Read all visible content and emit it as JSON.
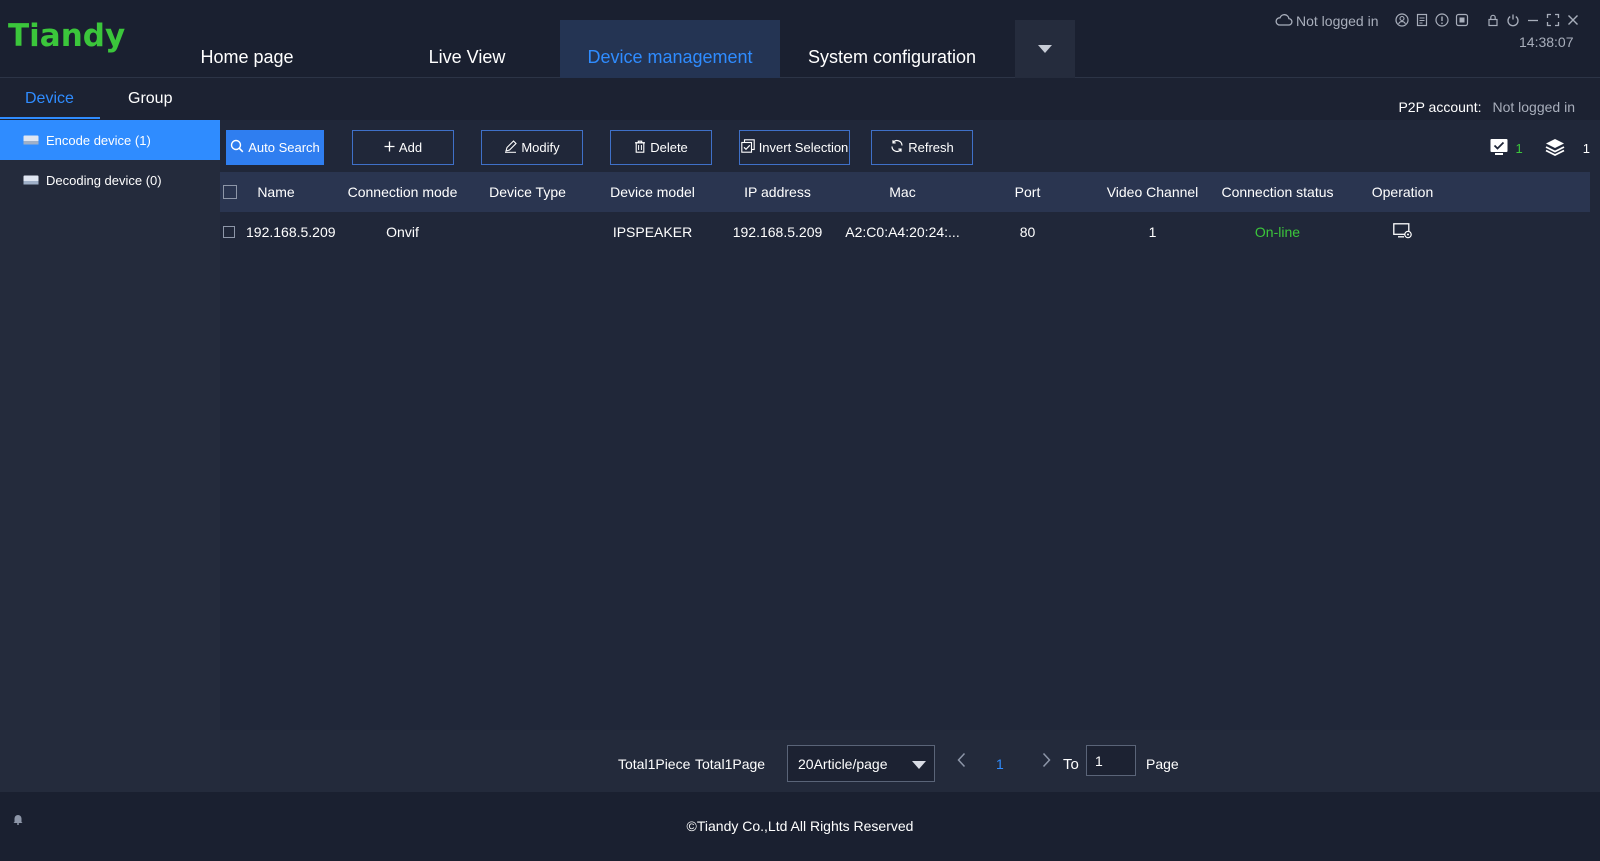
{
  "app": {
    "logo": "Tiandy",
    "nav": [
      "Home page",
      "Live View",
      "Device management",
      "System configuration"
    ],
    "active_nav": "Device management",
    "cloud_status": "Not logged in",
    "clock": "14:38:07"
  },
  "subnav": {
    "tabs": [
      "Device",
      "Group"
    ],
    "active_tab": "Device",
    "p2p_label": "P2P account:",
    "p2p_value": "Not logged in"
  },
  "sidebar": {
    "items": [
      {
        "label": "Encode device (1)",
        "icon": "device-icon"
      },
      {
        "label": "Decoding device (0)",
        "icon": "device-icon"
      }
    ],
    "active_index": 0
  },
  "toolbar": {
    "auto_search": "Auto Search",
    "add": "Add",
    "modify": "Modify",
    "delete": "Delete",
    "invert_selection": "Invert Selection",
    "refresh": "Refresh",
    "online_count": "1",
    "total_count": "1"
  },
  "table": {
    "columns": [
      "Name",
      "Connection mode",
      "Device Type",
      "Device model",
      "IP address",
      "Mac",
      "Port",
      "Video Channel",
      "Connection status",
      "Operation"
    ],
    "rows": [
      {
        "name": "192.168.5.209",
        "connection_mode": "Onvif",
        "device_type": "",
        "device_model": "IPSPEAKER",
        "ip": "192.168.5.209",
        "mac": "A2:C0:A4:20:24:...",
        "port": "80",
        "video_channel": "1",
        "status": "On-line",
        "operation_icon": "device-settings-icon"
      }
    ]
  },
  "pagination": {
    "total_pieces": "Total1Piece",
    "total_pages": "Total1Page",
    "page_size": "20Article/page",
    "current_page": "1",
    "goto_label": "To",
    "goto_value": "1",
    "page_label": "Page"
  },
  "footer": {
    "copyright": "©Tiandy Co.,Ltd All Rights Reserved"
  },
  "colors": {
    "brand_green": "#3bc63b",
    "accent_blue": "#2f8cff",
    "status_online": "#3bc63b"
  }
}
